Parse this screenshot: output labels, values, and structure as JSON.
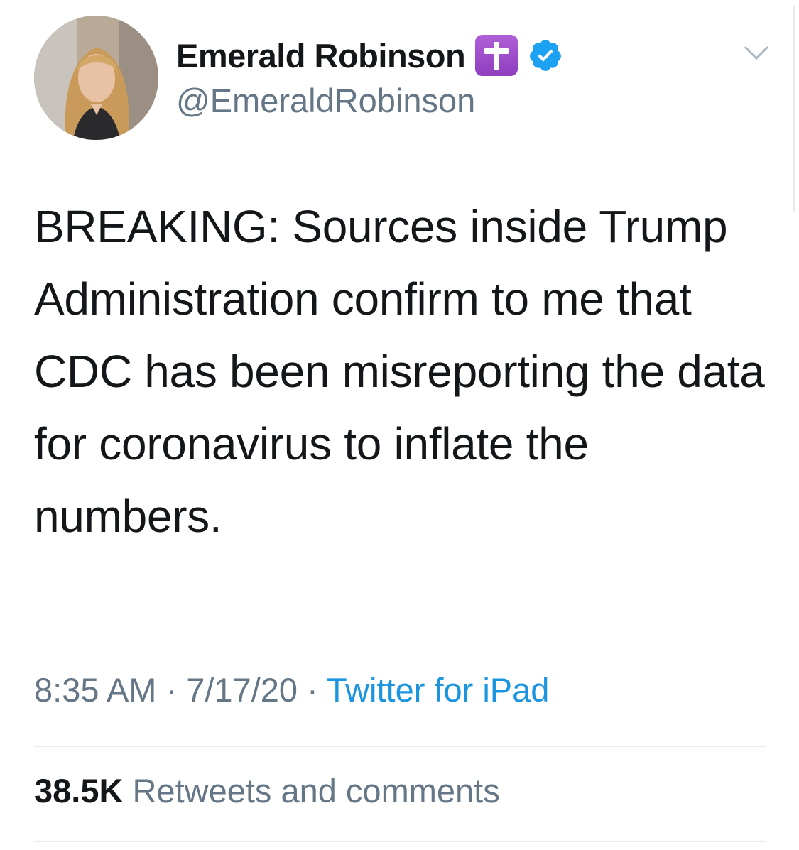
{
  "author": {
    "display_name": "Emerald Robinson",
    "handle": "@EmeraldRobinson",
    "badges": [
      "latin-cross-emoji",
      "verified-badge"
    ],
    "avatar": "profile-photo"
  },
  "tweet": {
    "text": "BREAKING: Sources inside Trump Administration confirm to me that CDC has been misreporting the data for coronavirus to inflate the numbers.",
    "time": "8:35 AM",
    "separator": "·",
    "date": "7/17/20",
    "source": "Twitter for iPad"
  },
  "stats": {
    "count": "38.5K",
    "label": "Retweets and comments"
  },
  "colors": {
    "primary_text": "#14171a",
    "secondary_text": "#657786",
    "link": "#1b95e0",
    "verified": "#1da1f2",
    "cross_badge": "#9b4dca",
    "divider": "#e6ecf0"
  }
}
